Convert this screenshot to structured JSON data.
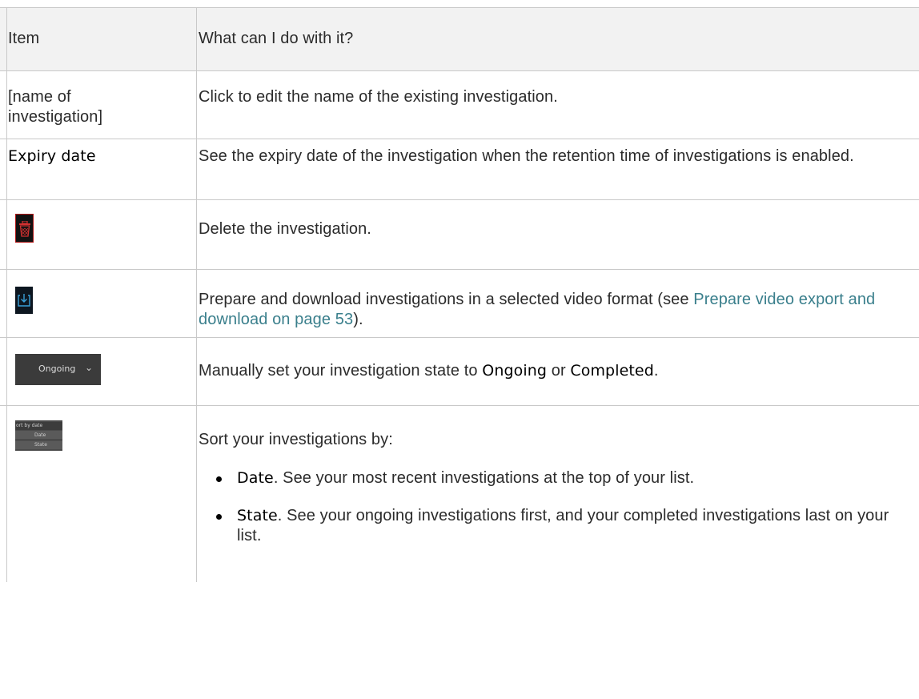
{
  "table": {
    "header": {
      "col_item": "Item",
      "col_what": "What can I do with it?"
    },
    "rows": [
      {
        "item": "[name of investigation]",
        "desc": "Click to edit the name of the existing investigation."
      },
      {
        "item": "Expiry date",
        "desc": "See the expiry date of the investigation when the retention time of investigations is enabled."
      },
      {
        "icon": "trash-icon",
        "desc": "Delete the investigation."
      },
      {
        "icon": "download-icon",
        "desc_before": "Prepare and download investigations in a selected video format (see ",
        "link": "Prepare video export and download on page 53",
        "desc_after": ")."
      },
      {
        "dropdown_label": "Ongoing",
        "desc_before": "Manually set your investigation state to ",
        "term1": "Ongoing",
        "desc_mid": " or ",
        "term2": "Completed",
        "desc_after": "."
      },
      {
        "sort_widget": {
          "label": "ort by date",
          "options": [
            "Date",
            "State"
          ]
        },
        "desc": "Sort your investigations by:",
        "bullets": [
          {
            "term": "Date",
            "text": ". See your most recent investigations at the top of your list."
          },
          {
            "term": "State",
            "text": ". See your ongoing investigations first, and your completed investigations last on your list."
          }
        ]
      }
    ]
  },
  "colors": {
    "border": "#c9c9c9",
    "header_bg": "#f2f2f2",
    "link": "#3a7f8c",
    "delete_red": "#b01818"
  }
}
